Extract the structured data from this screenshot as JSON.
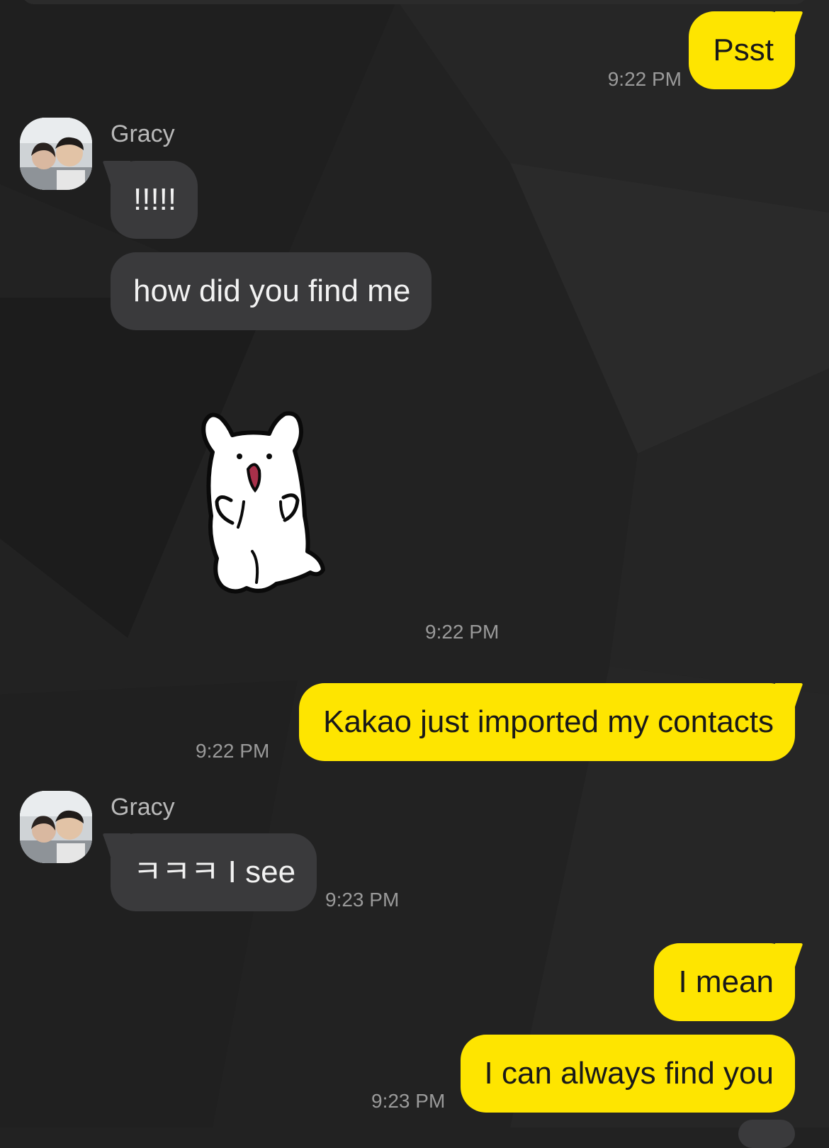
{
  "contact": {
    "name": "Gracy"
  },
  "messages": [
    {
      "id": "m1",
      "side": "out",
      "text": "Psst",
      "time": "9:22 PM"
    },
    {
      "id": "m2",
      "side": "in",
      "text": "!!!!!"
    },
    {
      "id": "m3",
      "side": "in",
      "text": "how did you find me"
    },
    {
      "id": "m4",
      "side": "in",
      "type": "sticker",
      "sticker_icon": "white-bear-surprised-sticker",
      "time": "9:22 PM"
    },
    {
      "id": "m5",
      "side": "out",
      "text": "Kakao just imported my contacts",
      "time": "9:22 PM"
    },
    {
      "id": "m6",
      "side": "in",
      "text": "ㅋㅋㅋ I see",
      "time": "9:23 PM"
    },
    {
      "id": "m7",
      "side": "out",
      "text": "I mean"
    },
    {
      "id": "m8",
      "side": "out",
      "text": "I can always find you",
      "time": "9:23 PM"
    }
  ],
  "colors": {
    "background": "#222222",
    "outgoing_bubble": "#fee500",
    "incoming_bubble": "#3a3a3c",
    "timestamp": "#9a9a9a"
  }
}
